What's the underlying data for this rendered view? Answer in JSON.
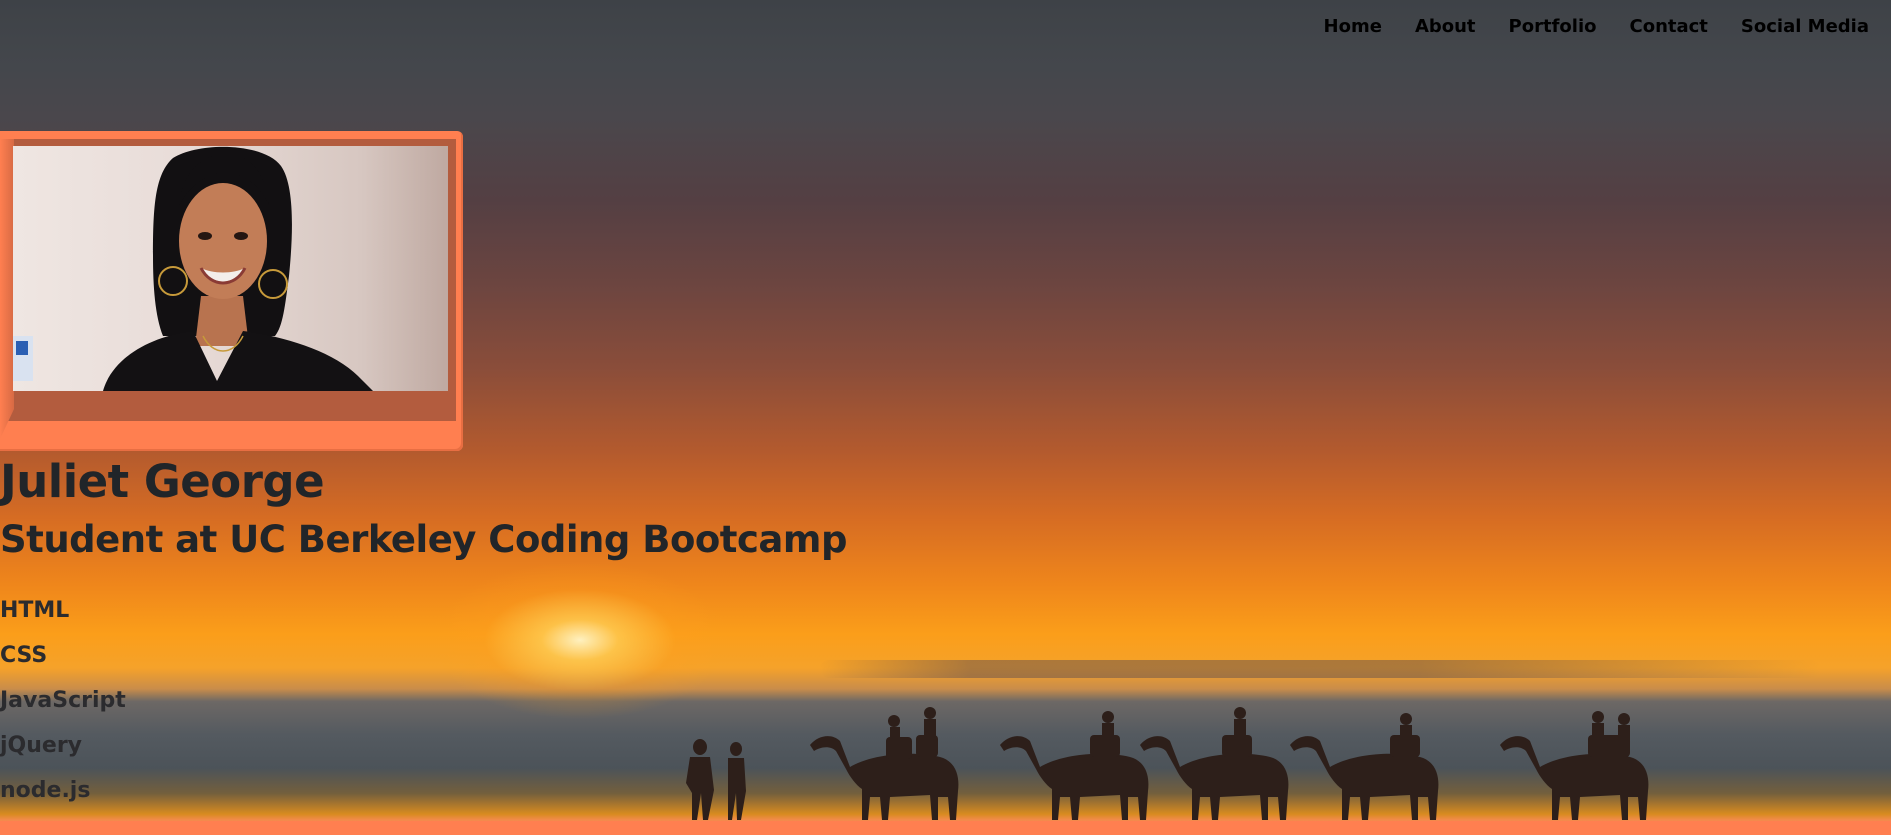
{
  "nav": {
    "items": [
      {
        "label": "Home"
      },
      {
        "label": "About"
      },
      {
        "label": "Portfolio"
      },
      {
        "label": "Contact"
      },
      {
        "label": "Social Media"
      }
    ]
  },
  "profile": {
    "name": "Juliet George",
    "subtitle": "Student at UC Berkeley Coding Bootcamp",
    "skills": [
      "HTML",
      "CSS",
      "JavaScript",
      "jQuery",
      "node.js"
    ]
  },
  "colors": {
    "accent": "#ff7f50",
    "text_dark": "#212529",
    "nav_text": "#000000"
  }
}
